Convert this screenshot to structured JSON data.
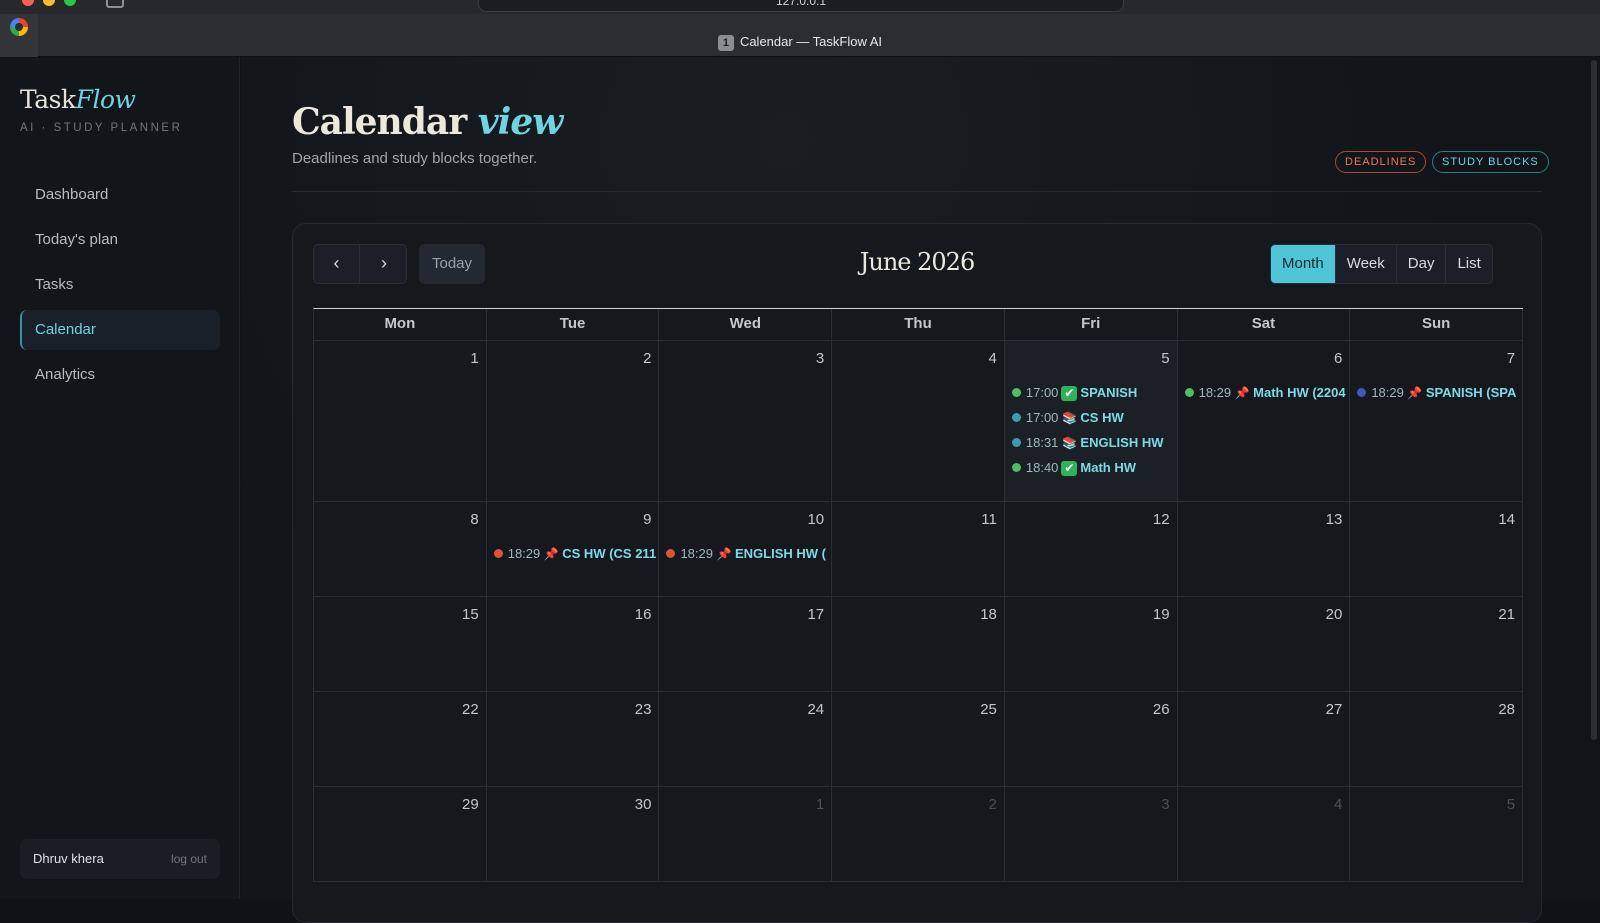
{
  "browser": {
    "url": "127.0.0.1",
    "tab": {
      "number": "1",
      "title": "Calendar — TaskFlow AI"
    }
  },
  "sidebar": {
    "brand_a": "Task",
    "brand_b": "Flow",
    "brand_sub": "AI · STUDY PLANNER",
    "items": [
      {
        "label": "Dashboard"
      },
      {
        "label": "Today's plan"
      },
      {
        "label": "Tasks"
      },
      {
        "label": "Calendar"
      },
      {
        "label": "Analytics"
      }
    ],
    "active_item": "Calendar",
    "user": {
      "name": "Dhruv khera",
      "logout": "log out"
    }
  },
  "header": {
    "title_a": "Calendar",
    "title_b": "view",
    "subtitle": "Deadlines and study blocks together.",
    "pill_deadlines": "DEADLINES",
    "pill_study": "STUDY BLOCKS"
  },
  "calendar": {
    "prev_icon": "chevron-left-icon",
    "next_icon": "chevron-right-icon",
    "today_label": "Today",
    "month_label": "June 2026",
    "views": [
      "Month",
      "Week",
      "Day",
      "List"
    ],
    "active_view": "Month",
    "weekdays": [
      "Mon",
      "Tue",
      "Wed",
      "Thu",
      "Fri",
      "Sat",
      "Sun"
    ],
    "weeks": [
      [
        {
          "n": "1",
          "events": []
        },
        {
          "n": "2",
          "events": []
        },
        {
          "n": "3",
          "events": []
        },
        {
          "n": "4",
          "events": []
        },
        {
          "n": "5",
          "today": true,
          "events": [
            {
              "dot": "green",
              "time": "17:00",
              "icon": "check",
              "title": "SPANISH"
            },
            {
              "dot": "teal",
              "time": "17:00",
              "icon": "book",
              "title": "CS HW"
            },
            {
              "dot": "teal",
              "time": "18:31",
              "icon": "book",
              "title": "ENGLISH HW"
            },
            {
              "dot": "green",
              "time": "18:40",
              "icon": "check",
              "title": "Math HW"
            }
          ]
        },
        {
          "n": "6",
          "events": [
            {
              "dot": "green",
              "time": "18:29",
              "icon": "pin",
              "title": "Math HW (2204"
            }
          ]
        },
        {
          "n": "7",
          "events": [
            {
              "dot": "blue",
              "time": "18:29",
              "icon": "pin",
              "title": "SPANISH (SPA"
            }
          ]
        }
      ],
      [
        {
          "n": "8",
          "events": []
        },
        {
          "n": "9",
          "events": [
            {
              "dot": "red",
              "time": "18:29",
              "icon": "pin",
              "title": "CS HW (CS 211"
            }
          ]
        },
        {
          "n": "10",
          "events": [
            {
              "dot": "red",
              "time": "18:29",
              "icon": "pin",
              "title": "ENGLISH HW ("
            }
          ]
        },
        {
          "n": "11",
          "events": []
        },
        {
          "n": "12",
          "events": []
        },
        {
          "n": "13",
          "events": []
        },
        {
          "n": "14",
          "events": []
        }
      ],
      [
        {
          "n": "15",
          "events": []
        },
        {
          "n": "16",
          "events": []
        },
        {
          "n": "17",
          "events": []
        },
        {
          "n": "18",
          "events": []
        },
        {
          "n": "19",
          "events": []
        },
        {
          "n": "20",
          "events": []
        },
        {
          "n": "21",
          "events": []
        }
      ],
      [
        {
          "n": "22",
          "events": []
        },
        {
          "n": "23",
          "events": []
        },
        {
          "n": "24",
          "events": []
        },
        {
          "n": "25",
          "events": []
        },
        {
          "n": "26",
          "events": []
        },
        {
          "n": "27",
          "events": []
        },
        {
          "n": "28",
          "events": []
        }
      ],
      [
        {
          "n": "29",
          "events": []
        },
        {
          "n": "30",
          "events": []
        },
        {
          "n": "1",
          "other": true,
          "events": []
        },
        {
          "n": "2",
          "other": true,
          "events": []
        },
        {
          "n": "3",
          "other": true,
          "events": []
        },
        {
          "n": "4",
          "other": true,
          "events": []
        },
        {
          "n": "5",
          "other": true,
          "events": []
        }
      ]
    ]
  },
  "colors": {
    "accent": "#4fc6d8",
    "deadline": "#e87a5d",
    "done": "#4dbf5f"
  }
}
